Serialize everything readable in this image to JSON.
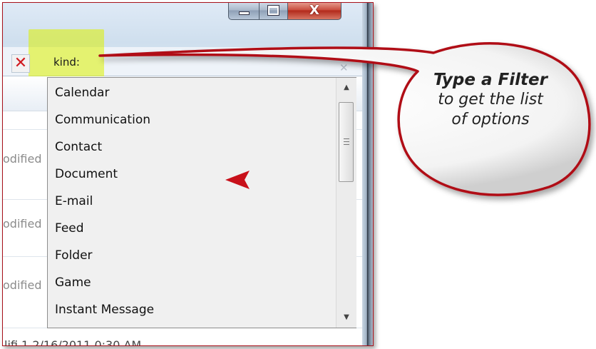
{
  "search": {
    "value": "kind:",
    "clear_glyph": "✕"
  },
  "window_controls": {
    "minimize_icon": "minimize-icon",
    "maximize_icon": "maximize-icon",
    "close_glyph": "X"
  },
  "filter_dropdown": {
    "options": [
      "Calendar",
      "Communication",
      "Contact",
      "Document",
      "E-mail",
      "Feed",
      "Folder",
      "Game",
      "Instant Message"
    ],
    "scroll_up_glyph": "▲",
    "scroll_down_glyph": "▼"
  },
  "file_list": {
    "modified_labels": [
      "odified",
      "odified",
      "odified"
    ],
    "bottom_row_text": "lifi 1 2/16/2011 0:30 AM"
  },
  "callout": {
    "title": "Type a Filter",
    "line1": "to get the list",
    "line2": "of options"
  },
  "colors": {
    "highlight": "#dcf000",
    "callout_border": "#b01018",
    "arrow": "#c8101a"
  }
}
